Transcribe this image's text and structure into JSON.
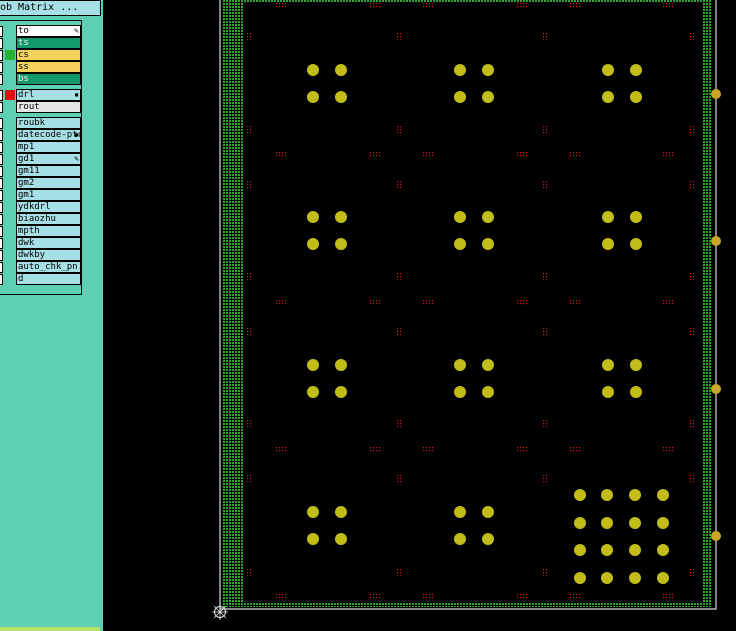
{
  "window": {
    "title": "ob Matrix ..."
  },
  "layers": [
    {
      "name": "to",
      "bg": "#ffffff",
      "fg": "#000000",
      "swatch": "",
      "mark": "pencil"
    },
    {
      "name": "ts",
      "bg": "#129a6c",
      "fg": "#e8f5e8",
      "swatch": "",
      "mark": ""
    },
    {
      "name": "cs",
      "bg": "#f4d25c",
      "fg": "#000000",
      "swatch": "#27b22f",
      "mark": ""
    },
    {
      "name": "ss",
      "bg": "#f4d25c",
      "fg": "#000000",
      "swatch": "",
      "mark": ""
    },
    {
      "name": "bs",
      "bg": "#129a6c",
      "fg": "#e8f5e8",
      "swatch": "",
      "mark": ""
    },
    {
      "name": "drl",
      "bg": "#a6dfe4",
      "fg": "#000000",
      "swatch": "#e01010",
      "mark": "square"
    },
    {
      "name": "rout",
      "bg": "#e6e6e6",
      "fg": "#000000",
      "swatch": "",
      "mark": ""
    },
    {
      "name": "roubk",
      "bg": "#a6dfe4",
      "fg": "#000000",
      "swatch": "",
      "mark": ""
    },
    {
      "name": "datecode-ptc",
      "bg": "#a6dfe4",
      "fg": "#000000",
      "swatch": "",
      "mark": "square"
    },
    {
      "name": "mp1",
      "bg": "#a6dfe4",
      "fg": "#000000",
      "swatch": "",
      "mark": ""
    },
    {
      "name": "gd1",
      "bg": "#a6dfe4",
      "fg": "#000000",
      "swatch": "",
      "mark": "pencil"
    },
    {
      "name": "gm11",
      "bg": "#a6dfe4",
      "fg": "#000000",
      "swatch": "",
      "mark": ""
    },
    {
      "name": "gm2",
      "bg": "#a6dfe4",
      "fg": "#000000",
      "swatch": "",
      "mark": ""
    },
    {
      "name": "gm1",
      "bg": "#a6dfe4",
      "fg": "#000000",
      "swatch": "",
      "mark": ""
    },
    {
      "name": "ydkdrl",
      "bg": "#a6dfe4",
      "fg": "#000000",
      "swatch": "",
      "mark": ""
    },
    {
      "name": "biaozhu",
      "bg": "#a6dfe4",
      "fg": "#000000",
      "swatch": "",
      "mark": ""
    },
    {
      "name": "mpth",
      "bg": "#a6dfe4",
      "fg": "#000000",
      "swatch": "",
      "mark": ""
    },
    {
      "name": "dwk",
      "bg": "#a6dfe4",
      "fg": "#000000",
      "swatch": "",
      "mark": ""
    },
    {
      "name": "dwkby",
      "bg": "#a6dfe4",
      "fg": "#000000",
      "swatch": "",
      "mark": ""
    },
    {
      "name": "auto_chk_pn.",
      "bg": "#a6dfe4",
      "fg": "#000000",
      "swatch": "",
      "mark": ""
    },
    {
      "name": "d",
      "bg": "#a6dfe4",
      "fg": "#000000",
      "swatch": "",
      "mark": ""
    }
  ],
  "colors": {
    "panel_bg": "#5ecfb2",
    "canvas_bg": "#000000",
    "outline": "#d8d8d8",
    "border_dots": "#2fa52f",
    "pad": "#c2bc18",
    "marker": "#d01818",
    "edge_tab": "#c9a629"
  },
  "icons": {
    "origin": "crosshair-origin-icon"
  }
}
